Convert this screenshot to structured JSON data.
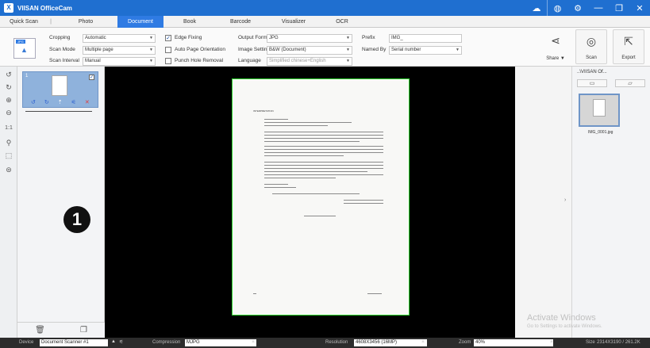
{
  "app": {
    "title": "VIISAN OfficeCam",
    "logo_glyph": "X"
  },
  "titlebar_icons": [
    "cloud-icon",
    "globe-icon",
    "settings-icon",
    "minimize-icon",
    "restore-icon",
    "close-icon"
  ],
  "tabs": [
    {
      "label": "Quick Scan",
      "active": false
    },
    {
      "label": "Photo",
      "active": false
    },
    {
      "label": "Document",
      "active": true
    },
    {
      "label": "Book",
      "active": false
    },
    {
      "label": "Barcode",
      "active": false
    },
    {
      "label": "Visualizer",
      "active": false
    },
    {
      "label": "OCR",
      "active": false
    }
  ],
  "ribbon": {
    "mode_icon_tag": "JPG",
    "cropping_label": "Cropping",
    "cropping_value": "Automatic",
    "scan_mode_label": "Scan Mode",
    "scan_mode_value": "Multiple page",
    "scan_interval_label": "Scan Interval",
    "scan_interval_value": "Manual",
    "edge_fixing_label": "Edge Fixing",
    "edge_fixing_checked": true,
    "auto_orientation_label": "Auto Page Orientation",
    "auto_orientation_checked": false,
    "punch_hole_label": "Punch Hole Removal",
    "punch_hole_checked": false,
    "output_format_label": "Output Format",
    "output_format_value": "JPG",
    "image_settings_label": "Image Settings",
    "image_settings_value": "B&W (Document)",
    "language_label": "Language",
    "language_value": "Simplified chinese+English",
    "prefix_label": "Prefix",
    "prefix_value": "IMG_",
    "named_by_label": "Named By",
    "named_by_value": "Serial number",
    "share_label": "Share ▼",
    "scan_label": "Scan",
    "export_label": "Export"
  },
  "thumbnails": {
    "items": [
      {
        "number": "1",
        "checked": true
      }
    ],
    "badge": "1"
  },
  "file_panel": {
    "path": "..\\VIISAN Of...",
    "files": [
      {
        "name": "IMG_0001.jpg"
      }
    ]
  },
  "document": {
    "heading": "INTERPRETATION"
  },
  "watermark": {
    "line1": "Activate Windows",
    "line2": "Go to Settings to activate Windows."
  },
  "statusbar": {
    "device_label": "Device",
    "device_value": "Document Scanner #1",
    "compression_label": "Compression",
    "compression_value": "MJPG",
    "resolution_label": "Resolution",
    "resolution_value": "4608X3456 (16MP)",
    "zoom_label": "Zoom",
    "zoom_value": "40%",
    "size_label": "Size",
    "size_value": "2314X3190 / 261.2K"
  }
}
